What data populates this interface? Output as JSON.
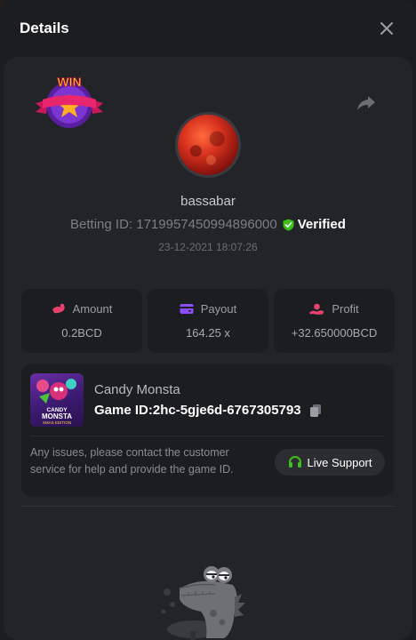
{
  "header": {
    "title": "Details"
  },
  "bet": {
    "win_badge_text": "WIN",
    "username": "bassabar",
    "betting_id": "Betting ID: 1719957450994896000",
    "verified_label": "Verified",
    "timestamp": "23-12-2021 18:07:26"
  },
  "stats": [
    {
      "label": "Amount",
      "value": "0.2BCD",
      "icon": "coins-icon",
      "icon_color": "#e8426b"
    },
    {
      "label": "Payout",
      "value": "164.25 x",
      "icon": "wallet-icon",
      "icon_color": "#8a4dff"
    },
    {
      "label": "Profit",
      "value": "+32.650000BCD",
      "icon": "hand-coin-icon",
      "icon_color": "#e8426b"
    }
  ],
  "game": {
    "name": "Candy Monsta",
    "game_id": "Game ID:2hc-5gje6d-6767305793",
    "thumb_title_line1": "CANDY",
    "thumb_title_line2": "MONSTA",
    "thumb_subtitle": "XMAS EDITION",
    "issues_text": "Any issues, please contact the customer service for help and provide the game ID.",
    "live_support_label": "Live Support"
  },
  "colors": {
    "background": "#1c1d21",
    "card": "#232428",
    "verified_green": "#3bc117",
    "accent_red": "#e8426b",
    "accent_purple": "#8a4dff"
  }
}
